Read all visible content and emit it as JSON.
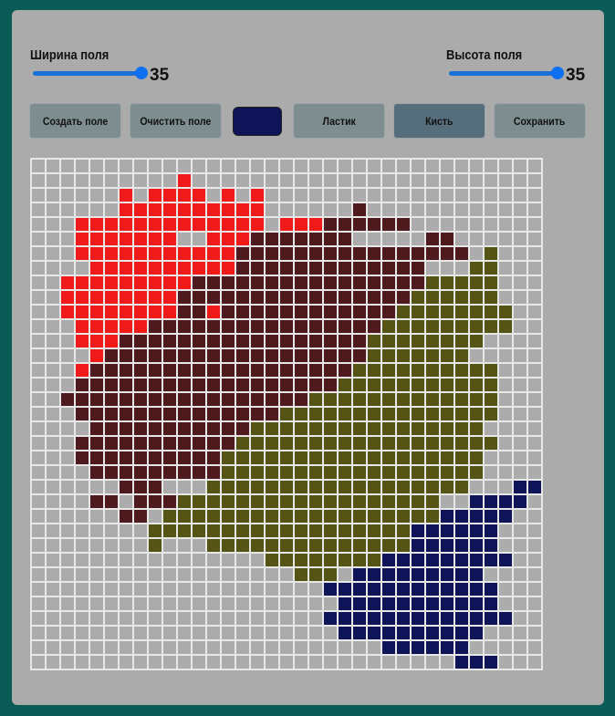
{
  "controls": {
    "width_label": "Ширина поля",
    "width_value": "35",
    "height_label": "Высота поля",
    "height_value": "35"
  },
  "toolbar": {
    "create_label": "Создать поле",
    "clear_label": "Очистить поле",
    "eraser_label": "Ластик",
    "brush_label": "Кисть",
    "save_label": "Сохранить"
  },
  "current_color": "#0f1357",
  "active_tool": "brush",
  "colors": {
    ".": "#acacac",
    "R": "#f01a1a",
    "M": "#4f1a1e",
    "O": "#555414",
    "N": "#0f1357"
  },
  "grid": {
    "cols": 35,
    "rows": 35,
    "pixels": [
      "...................................",
      "..........R........................",
      "......R.RRRR.R.R...................",
      "......RRRRRRRRRR......M............",
      "...RRRRRRRRRRRRR.RRRMMMMMM.........",
      "...RRRRRRR..RRRMMMMMMM.....MM......",
      "...RRRRRRRRRRRMMMMMMMMMMMMMMMM.O...",
      "....RRRRRRRRRRMMMMMMMMMMMMM...OO...",
      "..RRRRRRRRRMMMMMMMMMMMMMMMMOOOOO...",
      "..RRRRRRRRMMMMMMMMMMMMMMMMOOOOOO...",
      "..RRRRRRRRMMRMMMMMMMMMMMMOOOOOOOO..",
      "...RRRRRMMMMMMMMMMMMMMMMOOOOOOOOO..",
      "...RRRMMMMMMMMMMMMMMMMMOOOOOOOO....",
      "....RMMMMMMMMMMMMMMMMMMOOOOOOO.....",
      "...RMMMMMMMMMMMMMMMMMMOOOOOOOOOO...",
      "...MMMMMMMMMMMMMMMMMMOOOOOOOOOOO...",
      "..MMMMMMMMMMMMMMMMMOOOOOOOOOOOOO...",
      "...MMMMMMMMMMMMMMOOOOOOOOOOOOOOO...",
      "....MMMMMMMMMMMOOOOOOOOOOOOOOOO....",
      "...MMMMMMMMMMMOOOOOOOOOOOOOOOOOO...",
      "...MMMMMMMMMMOOOOOOOOOOOOOOOOOO....",
      "....MMMMMMMMMOOOOOOOOOOOOOOOOOO....",
      "......MMM...OOOOOOOOOOOOOOOOOO...NN",
      "....MM.MMMOOOOOOOOOOOOOOOOOO..NNNN.",
      "......MM.OOOOOOOOOOOOOOOOOOONNNNN..",
      "........OOOOOOOOOOOOOOOOOONNNNNN...",
      "........O...OOOOOOOOOOOOOONNNNNN...",
      "................OOOOOOOONNNNNNNNN..",
      "..................OOO.NNNNNNNNN....",
      "....................NNNNNNNNNNNN...",
      ".....................NNNNNNNNNNN...",
      "....................NNNNNNNNNNNNN..",
      ".....................NNNNNNNNNN....",
      "........................NNNNNN.....",
      ".............................NNN..."
    ]
  }
}
